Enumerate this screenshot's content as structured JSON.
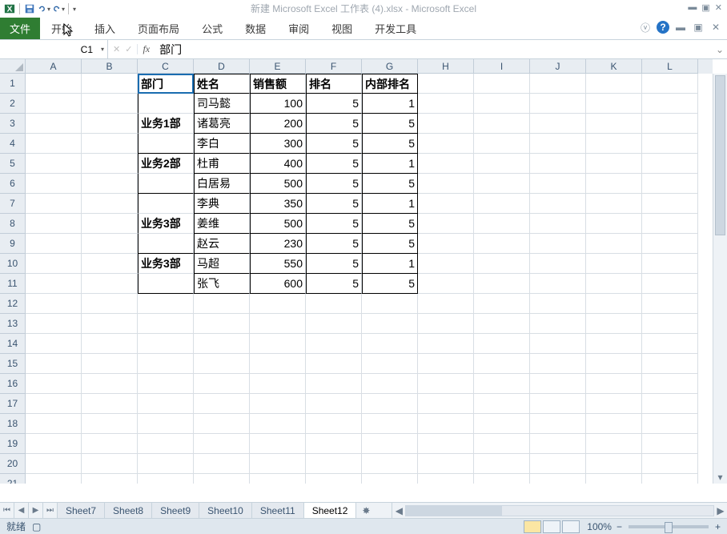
{
  "title": "新建 Microsoft Excel 工作表 (4).xlsx  -  Microsoft Excel",
  "ribbon": {
    "file": "文件",
    "tabs": [
      "开始",
      "插入",
      "页面布局",
      "公式",
      "数据",
      "审阅",
      "视图",
      "开发工具"
    ]
  },
  "namebox": "C1",
  "fx_label": "fx",
  "formula_value": "部门",
  "columns": [
    "A",
    "B",
    "C",
    "D",
    "E",
    "F",
    "G",
    "H",
    "I",
    "J",
    "K",
    "L"
  ],
  "row_count": 21,
  "headers": {
    "c": "部门",
    "d": "姓名",
    "e": "销售额",
    "f": "排名",
    "g": "内部排名"
  },
  "data": [
    {
      "dept": "业务1部",
      "rows": [
        {
          "name": "司马懿",
          "v": 100,
          "r": 5,
          "i": 1
        },
        {
          "name": "诸葛亮",
          "v": 200,
          "r": 5,
          "i": 5
        },
        {
          "name": "李白",
          "v": 300,
          "r": 5,
          "i": 5
        }
      ]
    },
    {
      "dept": "业务2部",
      "rows": [
        {
          "name": "杜甫",
          "v": 400,
          "r": 5,
          "i": 1
        },
        {
          "name": "白居易",
          "v": 500,
          "r": 5,
          "i": 5
        }
      ]
    },
    {
      "dept": "业务3部",
      "rows": [
        {
          "name": "李典",
          "v": 350,
          "r": 5,
          "i": 1
        },
        {
          "name": "姜维",
          "v": 500,
          "r": 5,
          "i": 5
        },
        {
          "name": "赵云",
          "v": 230,
          "r": 5,
          "i": 5
        }
      ]
    },
    {
      "dept": "业务3部",
      "rows": [
        {
          "name": "马超",
          "v": 550,
          "r": 5,
          "i": 1
        },
        {
          "name": "张飞",
          "v": 600,
          "r": 5,
          "i": 5
        }
      ]
    }
  ],
  "sheets": [
    "Sheet7",
    "Sheet8",
    "Sheet9",
    "Sheet10",
    "Sheet11",
    "Sheet12"
  ],
  "active_sheet": 5,
  "status": {
    "ready": "就绪",
    "zoom": "100%"
  },
  "zoom_controls": {
    "minus": "−",
    "plus": "+"
  }
}
